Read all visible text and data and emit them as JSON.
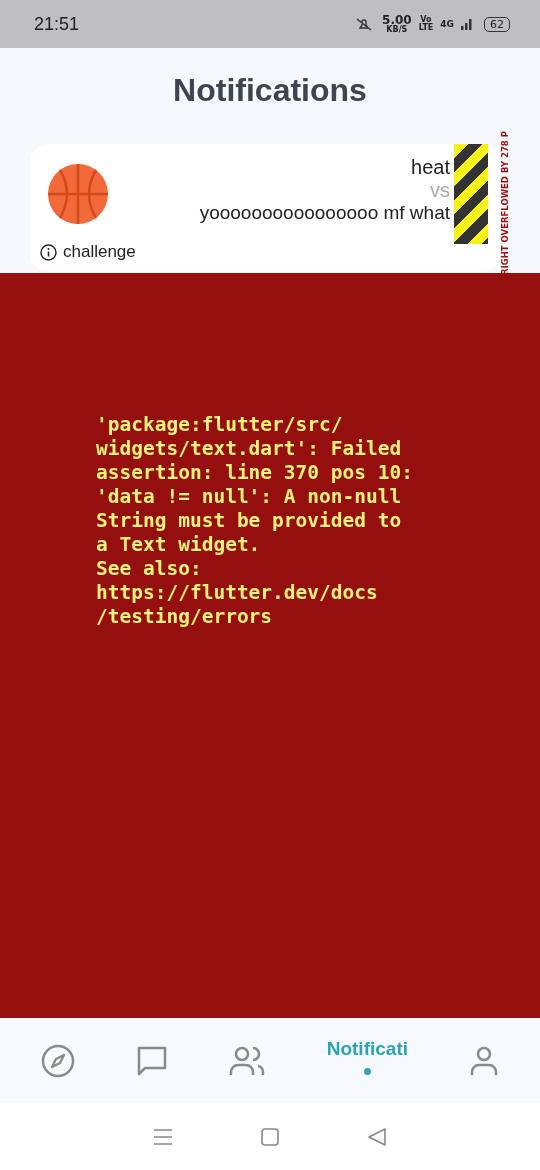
{
  "status_bar": {
    "time": "21:51",
    "speed": "5.00",
    "speed_unit": "KB/S",
    "volte_top": "Vo",
    "volte_bottom": "LTE",
    "network": "4G",
    "battery": "62"
  },
  "title": "Notifications",
  "notification": {
    "line_1": "heat",
    "line_2": "vs",
    "line_3": "yoooooooooooooooo mf what",
    "label": "challenge"
  },
  "overflow_warning": "RIGHT OVERFLOWED BY 278 P",
  "error_lines": [
    "'package:flutter/src/",
    "widgets/text.dart': Failed",
    "assertion: line 370 pos 10:",
    "'data != null': A non-null",
    "String must be provided to",
    "a Text widget.",
    "See also:",
    "https://flutter.dev/docs",
    "/testing/errors"
  ],
  "nav": [
    {
      "kind": "compass",
      "selected": false
    },
    {
      "kind": "chat",
      "selected": false
    },
    {
      "kind": "people",
      "selected": false
    },
    {
      "kind": "text",
      "label": "Notificati",
      "selected": true
    },
    {
      "kind": "person",
      "selected": false
    }
  ]
}
